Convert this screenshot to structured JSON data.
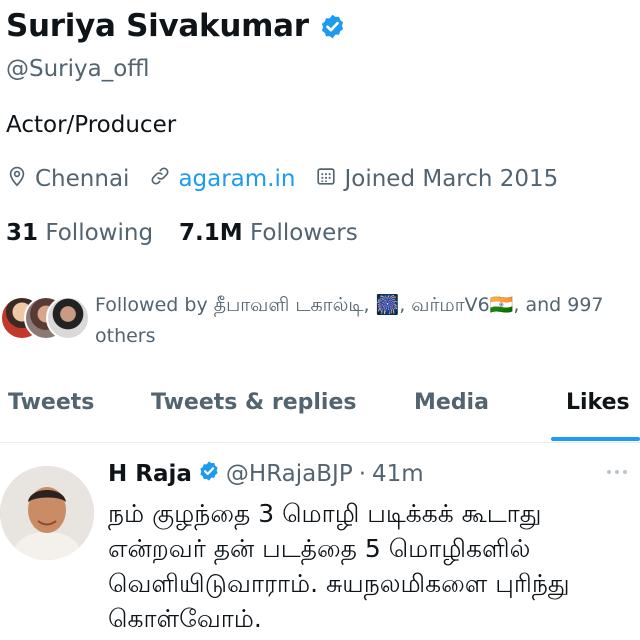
{
  "profile": {
    "display_name": "Suriya Sivakumar",
    "handle": "@Suriya_offl",
    "bio": "Actor/Producer",
    "location": "Chennai",
    "website": "agaram.in",
    "joined": "Joined March 2015",
    "following_count": "31",
    "following_label": "Following",
    "followers_count": "7.1M",
    "followers_label": "Followers",
    "followed_by_text": "Followed by தீபாவளி டகால்டி, 🎆, வர்மாV6🇮🇳, and 997 others"
  },
  "tabs": [
    {
      "label": "Tweets"
    },
    {
      "label": "Tweets & replies"
    },
    {
      "label": "Media"
    },
    {
      "label": "Likes"
    }
  ],
  "active_tab": "Likes",
  "tweet": {
    "author": "H Raja",
    "handle": "@HRajaBJP",
    "separator": "·",
    "time": "41m",
    "text": "நம் குழந்தை 3 மொழி படிக்கக் கூடாது என்றவர் தன் படத்தை 5 மொழிகளில் வெளியிடுவாராம். சுயநலமிகளை புரிந்து கொள்வோம்."
  },
  "colors": {
    "accent": "#1d9bf0",
    "secondary_text": "#536471",
    "primary_text": "#0f1419"
  },
  "icons": [
    "verified-badge-icon",
    "location-pin-icon",
    "link-icon",
    "calendar-icon",
    "more-options-icon"
  ]
}
